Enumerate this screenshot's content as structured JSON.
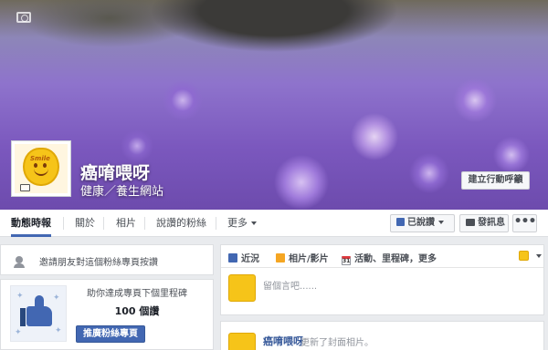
{
  "page": {
    "name": "癌唷喂呀",
    "category": "健康／養生網站",
    "cta_label": "建立行動呼籲",
    "profile_badge_text": "Smile"
  },
  "tabs": [
    {
      "label": "動態時報"
    },
    {
      "label": "關於"
    },
    {
      "label": "相片"
    },
    {
      "label": "說讚的粉絲"
    },
    {
      "label": "更多"
    }
  ],
  "actions": {
    "liked_label": "已說讚",
    "message_label": "發訊息",
    "more_label": "•••"
  },
  "sidebar": {
    "invite_text": "邀請朋友對這個粉絲專頁按讚",
    "promo_title": "助你達成專頁下個里程碑",
    "promo_count": "100 個讚",
    "promo_button": "推廣粉絲專頁"
  },
  "composer": {
    "tabs": [
      {
        "label": "近況",
        "icon": "edit-icon"
      },
      {
        "label": "相片/影片",
        "icon": "photo-icon"
      },
      {
        "label": "活動、里程碑，更多",
        "icon": "calendar-icon"
      }
    ],
    "calendar_day": "31",
    "placeholder": "留個言吧......"
  },
  "post": {
    "author": "癌唷喂呀",
    "action": "更新了封面相片。"
  },
  "colors": {
    "brand_blue": "#4267b2",
    "link_blue": "#365899",
    "page_bg": "#e9ebee"
  }
}
